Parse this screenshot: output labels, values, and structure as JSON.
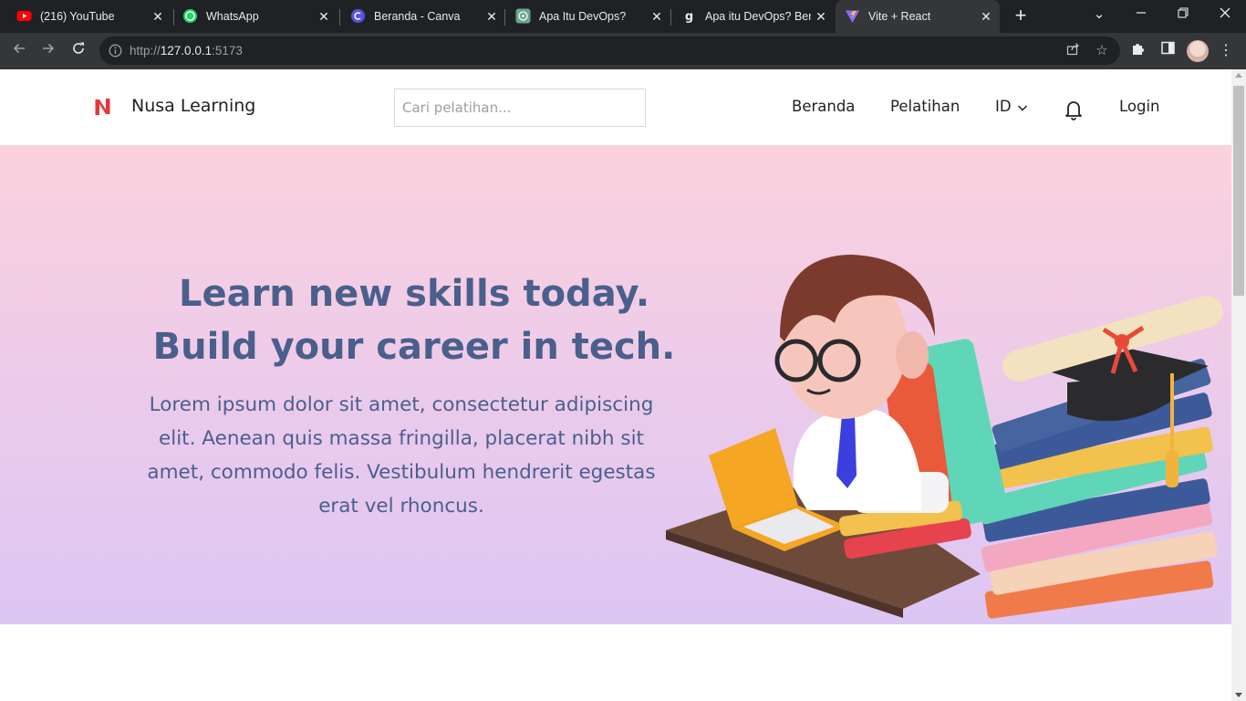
{
  "browser": {
    "tabs": [
      {
        "title": "(216) YouTube",
        "icon": "youtube-icon",
        "active": false
      },
      {
        "title": "WhatsApp",
        "icon": "whatsapp-icon",
        "active": false
      },
      {
        "title": "Beranda - Canva",
        "icon": "canva-icon",
        "active": false
      },
      {
        "title": "Apa Itu DevOps?",
        "icon": "chatgpt-icon",
        "active": false
      },
      {
        "title": "Apa itu DevOps? Berik",
        "icon": "glints-icon",
        "active": false
      },
      {
        "title": "Vite + React",
        "icon": "vite-icon",
        "active": true
      }
    ],
    "url_scheme": "http://",
    "url_host": "127.0.0.1",
    "url_port": ":5173"
  },
  "site": {
    "brand": "Nusa Learning",
    "logo_letter": "N",
    "search_placeholder": "Cari pelatihan...",
    "nav": {
      "home": "Beranda",
      "courses": "Pelatihan",
      "language": "ID",
      "login": "Login"
    },
    "hero": {
      "title_line1": "Learn new skills today.",
      "title_line2": "Build your career in tech.",
      "description": "Lorem ipsum dolor sit amet, consectetur adipiscing elit. Aenean quis massa fringilla, placerat nibh sit amet, commodo felis. Vestibulum hendrerit egestas erat vel rhoncus."
    }
  },
  "colors": {
    "logo_red": "#e8363b",
    "hero_text": "#4a5f8c",
    "hero_top": "#fbd1dc",
    "hero_bottom": "#dcc6f3"
  }
}
